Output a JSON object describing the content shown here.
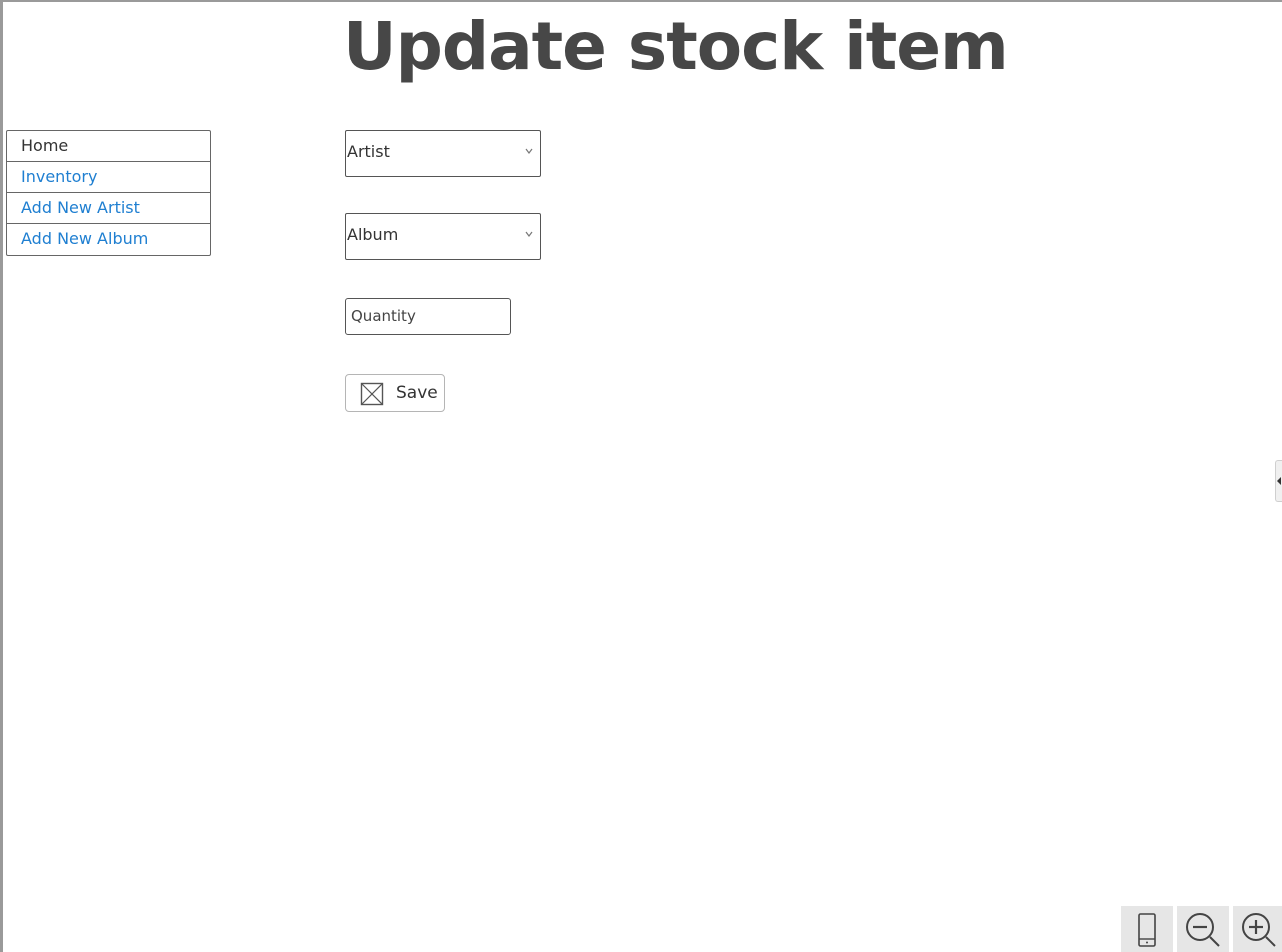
{
  "page": {
    "title": "Update stock item"
  },
  "nav": {
    "items": [
      {
        "label": "Home",
        "active": true
      },
      {
        "label": "Inventory",
        "active": false
      },
      {
        "label": "Add New Artist",
        "active": false
      },
      {
        "label": "Add New Album",
        "active": false
      }
    ]
  },
  "form": {
    "artist_select": {
      "label": "Artist"
    },
    "album_select": {
      "label": "Album"
    },
    "quantity_input": {
      "placeholder": "Quantity",
      "value": ""
    },
    "save_button": {
      "label": "Save",
      "icon": "image-placeholder-icon"
    }
  },
  "controls": {
    "panel_toggle_icon": "chevron-left-icon",
    "zoom_buttons": [
      {
        "icon": "device-icon"
      },
      {
        "icon": "zoom-out-icon"
      },
      {
        "icon": "zoom-in-icon"
      }
    ]
  },
  "colors": {
    "link": "#1f7fd1",
    "text": "#333333",
    "title": "#474747",
    "border": "#555555"
  }
}
